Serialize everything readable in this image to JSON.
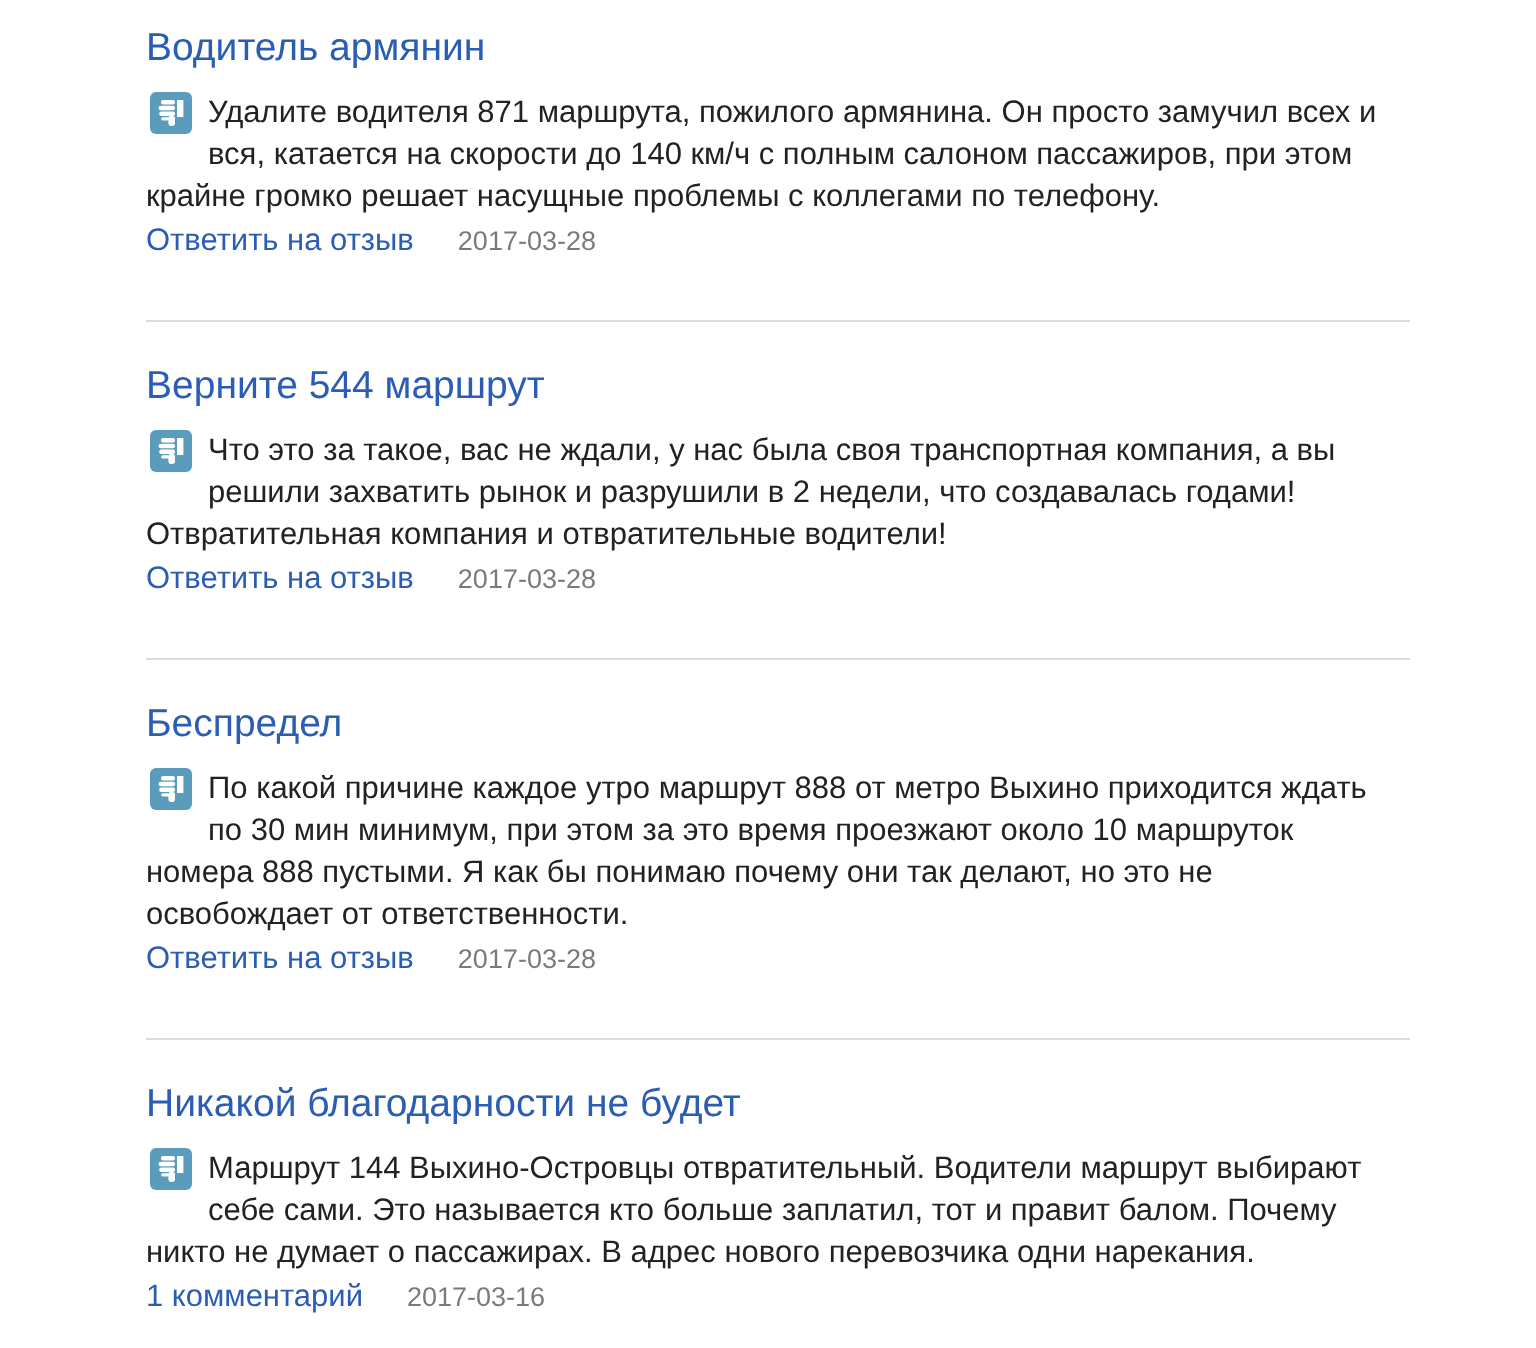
{
  "reviews": [
    {
      "title": "Водитель армянин",
      "thumbs_down": true,
      "text": "Удалите водителя 871 маршрута, пожилого армянина. Он просто замучил всех и вся, катается на скорости до 140 км/ч с полным салоном пассажиров, при этом крайне громко решает насущные проблемы с коллегами по телефону.",
      "link": "Ответить на отзыв",
      "date": "2017-03-28"
    },
    {
      "title": "Верните 544 маршрут",
      "thumbs_down": true,
      "text": "Что это за такое, вас не ждали, у нас была своя транспортная компания, а вы решили захватить рынок и разрушили в 2 недели, что создавалась годами! Отвратительная компания и отвратительные водители!",
      "link": "Ответить на отзыв",
      "date": "2017-03-28"
    },
    {
      "title": "Беспредел",
      "thumbs_down": true,
      "text": "По какой причине каждое утро маршрут 888 от метро Выхино приходится ждать по 30 мин минимум, при этом за это время проезжают около 10 маршруток номера 888 пустыми. Я как бы понимаю почему они так делают, но это не освобождает от ответственности.",
      "link": "Ответить на отзыв",
      "date": "2017-03-28"
    },
    {
      "title": "Никакой благодарности не будет",
      "thumbs_down": true,
      "text": "Маршрут 144 Выхино-Островцы отвратительный. Водители маршрут выбирают себе сами. Это называется кто больше заплатил, тот и правит балом. Почему никто не думает о пассажирах. В адрес нового перевозчика одни нарекания.",
      "link": "1 комментарий",
      "date": "2017-03-16"
    }
  ]
}
